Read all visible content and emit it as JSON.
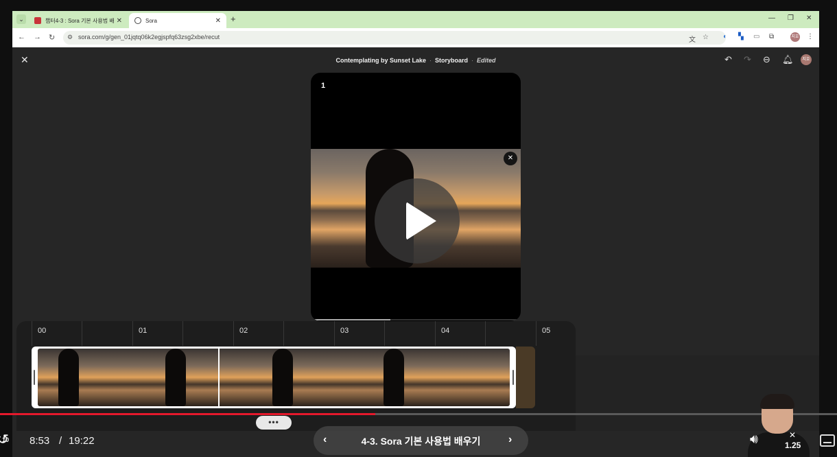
{
  "browser": {
    "tabs": [
      {
        "title": "챕터4-3 : Sora 기본 사용법 배",
        "close": "✕"
      },
      {
        "title": "Sora",
        "close": "✕"
      }
    ],
    "new_tab": "+",
    "url": "sora.com/g/gen_01jqtq06k2egjspfq63zsg2xbe/recut",
    "profile_initials": "지호"
  },
  "app": {
    "title_parts": {
      "name": "Contemplating by Sunset Lake",
      "separator": "·",
      "mode": "Storyboard",
      "status": "Edited"
    },
    "close_label": "✕",
    "avatar_initials": "지호"
  },
  "preview": {
    "frame_number": "1",
    "progress_fraction": 0.38
  },
  "timeline": {
    "ticks": [
      "00",
      "01",
      "02",
      "03",
      "04",
      "05"
    ],
    "playhead_fraction": 0.385
  },
  "player": {
    "progress_fraction": 0.448,
    "more_label": "•••",
    "rewind_seconds": "10",
    "current_time": "8:53",
    "time_separator": "/",
    "duration": "19:22",
    "lesson_title": "4-3. Sora 기본 사용법 배우기",
    "prev_label": "‹",
    "next_label": "›",
    "speed_close": "✕",
    "speed": "1.25"
  },
  "colors": {
    "accent_red": "#e5192c",
    "tab_bar": "#cdebbf",
    "app_bg": "#262626"
  },
  "icons": [
    "refresh-icon",
    "back-arrow-icon",
    "forward-arrow-icon",
    "reload-icon",
    "site-settings-icon",
    "translate-icon",
    "star-icon",
    "extension-icon",
    "menu-icon",
    "undo-icon",
    "redo-icon",
    "zoom-out-icon",
    "bell-icon",
    "play-icon",
    "volume-icon",
    "captions-icon",
    "rewind-icon"
  ]
}
